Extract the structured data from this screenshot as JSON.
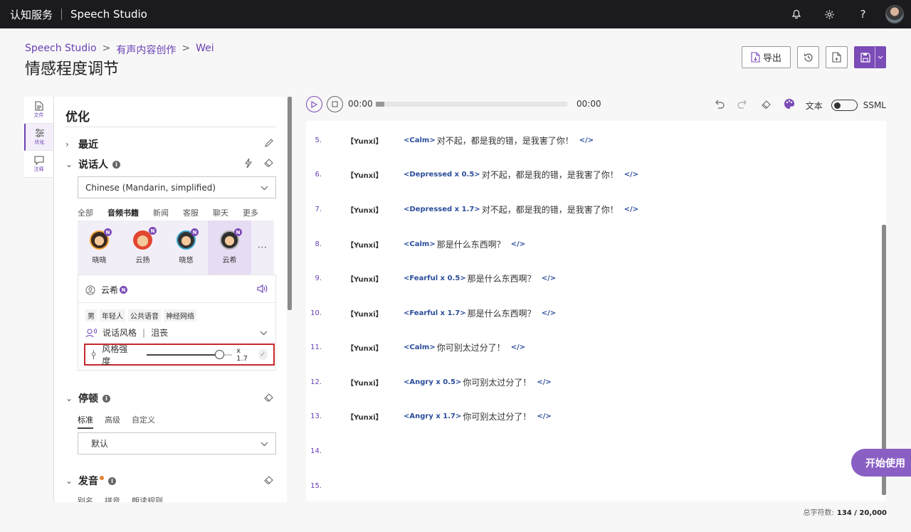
{
  "topbar": {
    "brand": "认知服务",
    "product": "Speech Studio"
  },
  "breadcrumb": [
    "Speech Studio",
    "有声内容创作",
    "Wei"
  ],
  "page_title": "情感程度调节",
  "header_buttons": {
    "export": "导出"
  },
  "sidenav": [
    {
      "label": "文件",
      "icon": "file-icon"
    },
    {
      "label": "优化",
      "icon": "sliders-icon"
    },
    {
      "label": "注释",
      "icon": "comment-icon"
    }
  ],
  "panel": {
    "title": "优化",
    "recent": "最近",
    "speaker_section": "说话人",
    "language": "Chinese (Mandarin, simplified)",
    "voice_tabs": [
      "全部",
      "音频书籍",
      "新闻",
      "客服",
      "聊天",
      "更多"
    ],
    "voices": [
      {
        "name": "晓晓",
        "badge": "N"
      },
      {
        "name": "云扬",
        "badge": "N"
      },
      {
        "name": "晓悠",
        "badge": "N"
      },
      {
        "name": "云希",
        "badge": "N"
      }
    ],
    "selected_voice": {
      "name": "云希",
      "badge": "N",
      "tags": [
        "男",
        "年轻人",
        "公共语音",
        "神经网络"
      ],
      "style_label": "说话风格",
      "style_value": "沮丧"
    },
    "intensity": {
      "label": "风格强度",
      "value_text": "x 1.7",
      "level": 0.85
    },
    "pause_section": "停顿",
    "pause_tabs": [
      "标准",
      "高级",
      "自定义"
    ],
    "pause_value": "默认",
    "pronunciation_section": "发音",
    "pronunciation_tabs": [
      "别名",
      "拼音",
      "朗读规则"
    ]
  },
  "player": {
    "current_time": "00:00",
    "total_time": "00:00",
    "progress": 0
  },
  "toolbar": {
    "text_label": "文本",
    "ssml_label": "SSML"
  },
  "lines": [
    {
      "no": "5.",
      "speaker": "【Yunxi】",
      "tag": "<Calm>",
      "text": "对不起，都是我的错，是我害了你！",
      "end": "</>"
    },
    {
      "no": "6.",
      "speaker": "【Yunxi】",
      "tag": "<Depressed x 0.5>",
      "text": "对不起，都是我的错，是我害了你！",
      "end": "</>"
    },
    {
      "no": "7.",
      "speaker": "【Yunxi】",
      "tag": "<Depressed x 1.7>",
      "text": "对不起，都是我的错，是我害了你！",
      "end": "</>"
    },
    {
      "no": "8.",
      "speaker": "【Yunxi】",
      "tag": "<Calm>",
      "text": "那是什么东西啊？",
      "end": "</>"
    },
    {
      "no": "9.",
      "speaker": "【Yunxi】",
      "tag": "<Fearful x 0.5>",
      "text": "那是什么东西啊？",
      "end": "</>"
    },
    {
      "no": "10.",
      "speaker": "【Yunxi】",
      "tag": "<Fearful x 1.7>",
      "text": "那是什么东西啊？",
      "end": "</>"
    },
    {
      "no": "11.",
      "speaker": "【Yunxi】",
      "tag": "<Calm>",
      "text": "你可别太过分了！",
      "end": "</>"
    },
    {
      "no": "12.",
      "speaker": "【Yunxi】",
      "tag": "<Angry x 0.5>",
      "text": "你可别太过分了！",
      "end": "</>"
    },
    {
      "no": "13.",
      "speaker": "【Yunxi】",
      "tag": "<Angry x 1.7>",
      "text": "你可别太过分了！",
      "end": "</>"
    },
    {
      "no": "14.",
      "speaker": "",
      "tag": "",
      "text": "",
      "end": ""
    },
    {
      "no": "15.",
      "speaker": "",
      "tag": "",
      "text": "",
      "end": ""
    }
  ],
  "cta": "开始使用",
  "counter": {
    "label": "总字符数:",
    "value": "134 / 20,000"
  },
  "colors": {
    "accent": "#7b4bb7",
    "topbar": "#1b1b1f",
    "highlight": "#c8282b",
    "tag": "#2a4d9b"
  }
}
